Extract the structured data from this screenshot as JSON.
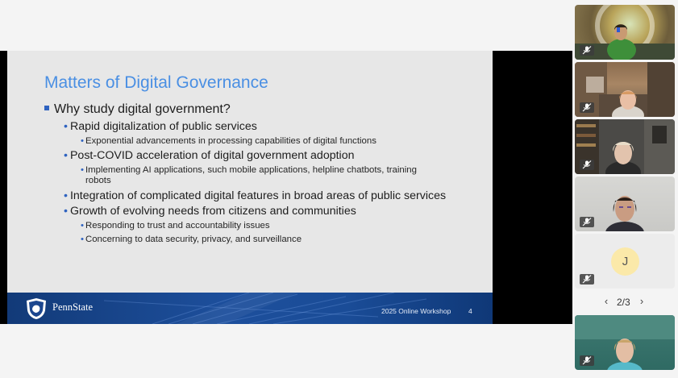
{
  "slide": {
    "title": "Matters of Digital Governance",
    "bullets": {
      "l1": "Why study digital government?",
      "rapid": "Rapid digitalization of public services",
      "rapid_sub": "Exponential advancements in processing capabilities of digital functions",
      "covid": "Post-COVID acceleration of digital government adoption",
      "covid_sub_1": "Implementing AI applications, such mobile applications, helpline chatbots, training",
      "covid_sub_2": "robots",
      "integration": "Integration of complicated digital features in broad areas of public services",
      "growth": "Growth of evolving needs from citizens and communities",
      "growth_sub_1": "Responding to trust and accountability issues",
      "growth_sub_2": "Concerning to data security, privacy, and surveillance"
    },
    "footer": {
      "brand": "PennState",
      "workshop": "2025 Online Workshop",
      "page": "4"
    }
  },
  "participants": {
    "avatar_initial": "J",
    "pager": "2/3"
  },
  "colors": {
    "title": "#4a8fe3",
    "bullet": "#2f63c0",
    "footer": "#1d4f9c",
    "avatar": "#fbe9a9"
  }
}
